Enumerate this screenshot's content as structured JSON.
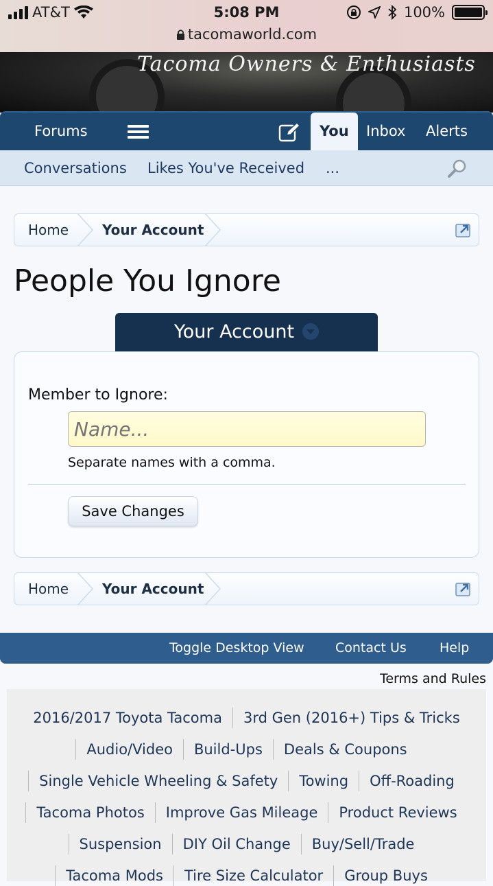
{
  "status_bar": {
    "carrier": "AT&T",
    "time": "5:08 PM",
    "battery": "100%",
    "url": "tacomaworld.com"
  },
  "banner": {
    "tagline": "Tacoma Owners & Enthusiasts"
  },
  "nav": {
    "forums": "Forums",
    "you": "You",
    "inbox": "Inbox",
    "alerts": "Alerts"
  },
  "subnav": {
    "conversations": "Conversations",
    "likes": "Likes You've Received",
    "more": "..."
  },
  "breadcrumb": {
    "home": "Home",
    "account": "Your Account"
  },
  "page": {
    "title": "People You Ignore",
    "tab": "Your Account"
  },
  "form": {
    "label": "Member to Ignore:",
    "placeholder": "Name...",
    "hint": "Separate names with a comma.",
    "save": "Save Changes"
  },
  "footer": {
    "toggle": "Toggle Desktop View",
    "contact": "Contact Us",
    "help": "Help",
    "terms": "Terms and Rules"
  },
  "forum_links": [
    [
      "2016/2017 Toyota Tacoma",
      "3rd Gen (2016+) Tips & Tricks"
    ],
    [
      "Audio/Video",
      "Build-Ups",
      "Deals & Coupons"
    ],
    [
      "Single Vehicle Wheeling & Safety",
      "Towing",
      "Off-Roading"
    ],
    [
      "Tacoma Photos",
      "Improve Gas Mileage",
      "Product Reviews"
    ],
    [
      "Suspension",
      "DIY Oil Change",
      "Buy/Sell/Trade"
    ],
    [
      "Tacoma Mods",
      "Tire Size Calculator",
      "Group Buys"
    ]
  ]
}
